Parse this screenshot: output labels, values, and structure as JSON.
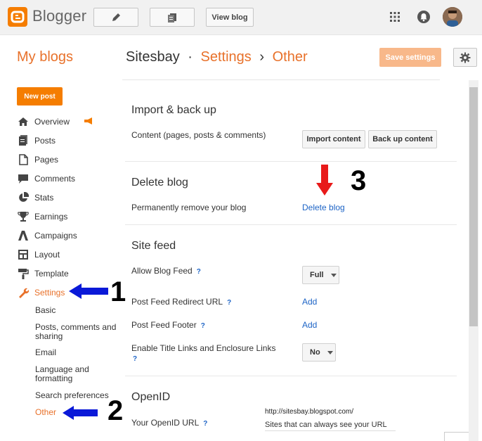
{
  "topbar": {
    "brand": "Blogger",
    "view_blog": "View blog"
  },
  "header": {
    "my_blogs": "My blogs",
    "blog_name": "Sitesbay",
    "sep1": "·",
    "settings": "Settings",
    "sep2": "›",
    "current": "Other",
    "save_settings": "Save settings"
  },
  "sidebar": {
    "new_post": "New post",
    "items": [
      {
        "label": "Overview"
      },
      {
        "label": "Posts"
      },
      {
        "label": "Pages"
      },
      {
        "label": "Comments"
      },
      {
        "label": "Stats"
      },
      {
        "label": "Earnings"
      },
      {
        "label": "Campaigns"
      },
      {
        "label": "Layout"
      },
      {
        "label": "Template"
      },
      {
        "label": "Settings"
      }
    ],
    "subitems": [
      {
        "label": "Basic"
      },
      {
        "label": "Posts, comments and sharing"
      },
      {
        "label": "Email"
      },
      {
        "label": "Language and formatting"
      },
      {
        "label": "Search preferences"
      },
      {
        "label": "Other"
      }
    ]
  },
  "annotations": {
    "one": "1",
    "two": "2",
    "three": "3"
  },
  "import_section": {
    "title": "Import & back up",
    "content_label": "Content (pages, posts & comments)",
    "import_btn": "Import content",
    "backup_btn": "Back up content"
  },
  "delete_section": {
    "title": "Delete blog",
    "label": "Permanently remove your blog",
    "link": "Delete blog"
  },
  "feed_section": {
    "title": "Site feed",
    "allow_label": "Allow Blog Feed",
    "allow_value": "Full",
    "redirect_label": "Post Feed Redirect URL",
    "redirect_link": "Add",
    "footer_label": "Post Feed Footer",
    "footer_link": "Add",
    "title_links_label": "Enable Title Links and Enclosure Links",
    "title_links_value": "No",
    "help": "?"
  },
  "openid_section": {
    "title": "OpenID",
    "url_label": "Your OpenID URL",
    "url_value": "http://sitesbay.blogspot.com/",
    "sites_label": "Sites that can always see your URL"
  },
  "colors": {
    "accent": "#e8712a",
    "brand": "#f57d00",
    "link": "#1d64c6",
    "arrow_blue": "#0a19d8",
    "arrow_red": "#e81a1a"
  }
}
